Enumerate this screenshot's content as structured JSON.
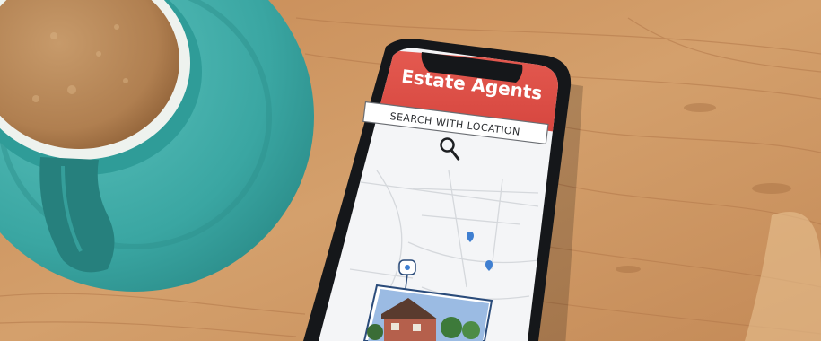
{
  "app": {
    "title": "Estate Agents",
    "search_label": "SEARCH WITH LOCATION"
  },
  "icons": {
    "search": "magnifier-icon",
    "pin": "location-pin-icon"
  },
  "colors": {
    "header_red": "#e0524a",
    "saucer_teal": "#3ba9a6",
    "table_wood": "#c8935f",
    "phone_black": "#15171a"
  }
}
